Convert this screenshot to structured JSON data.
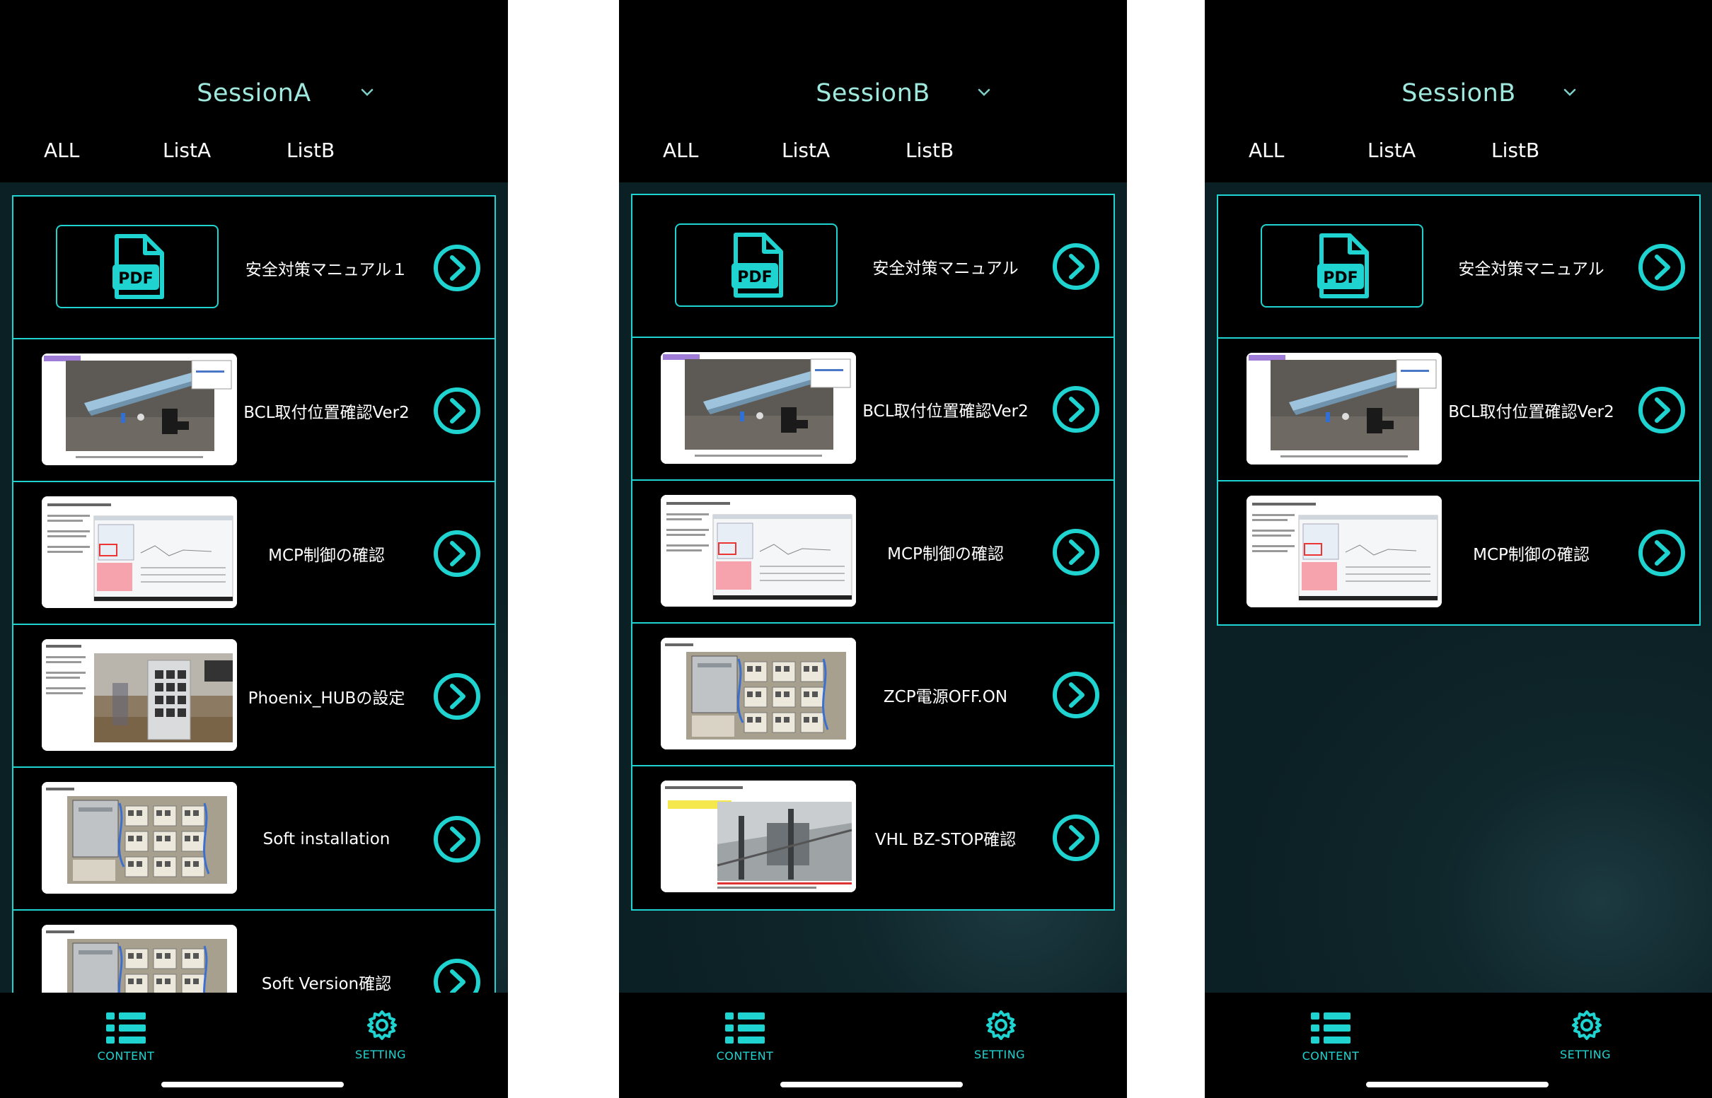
{
  "phones": [
    {
      "session": "SessionA",
      "tabs": [
        "ALL",
        "ListA",
        "ListB"
      ],
      "items": [
        {
          "title": "安全対策マニュアル１",
          "thumb": "pdf"
        },
        {
          "title": "BCL取付位置確認Ver2",
          "thumb": "rail"
        },
        {
          "title": "MCP制御の確認",
          "thumb": "doc"
        },
        {
          "title": "Phoenix_HUBの設定",
          "thumb": "hub"
        },
        {
          "title": "Soft installation",
          "thumb": "panel"
        },
        {
          "title": "Soft Version確認",
          "thumb": "panel2"
        }
      ]
    },
    {
      "session": "SessionB",
      "tabs": [
        "ALL",
        "ListA",
        "ListB"
      ],
      "items": [
        {
          "title": "安全対策マニュアル",
          "thumb": "pdf"
        },
        {
          "title": "BCL取付位置確認Ver2",
          "thumb": "rail"
        },
        {
          "title": "MCP制御の確認",
          "thumb": "doc"
        },
        {
          "title": "ZCP電源OFF.ON",
          "thumb": "panel"
        },
        {
          "title": "VHL BZ-STOP確認",
          "thumb": "track"
        }
      ]
    },
    {
      "session": "SessionB",
      "tabs": [
        "ALL",
        "ListA",
        "ListB"
      ],
      "items": [
        {
          "title": "安全対策マニュアル",
          "thumb": "pdf"
        },
        {
          "title": "BCL取付位置確認Ver2",
          "thumb": "rail"
        },
        {
          "title": "MCP制御の確認",
          "thumb": "doc"
        }
      ]
    }
  ],
  "nav": {
    "content_label": "CONTENT",
    "setting_label": "SETTING"
  },
  "pdf_label": "PDF",
  "colors": {
    "accent": "#1fd3d0",
    "session_text": "#9fe8de",
    "background": "#000000",
    "list_area": "#0f262b"
  },
  "icons": {
    "caret": "chevron-down-icon",
    "arrow": "chevron-right-circle-icon",
    "content": "list-icon",
    "setting": "gear-icon",
    "pdf": "pdf-file-icon"
  }
}
